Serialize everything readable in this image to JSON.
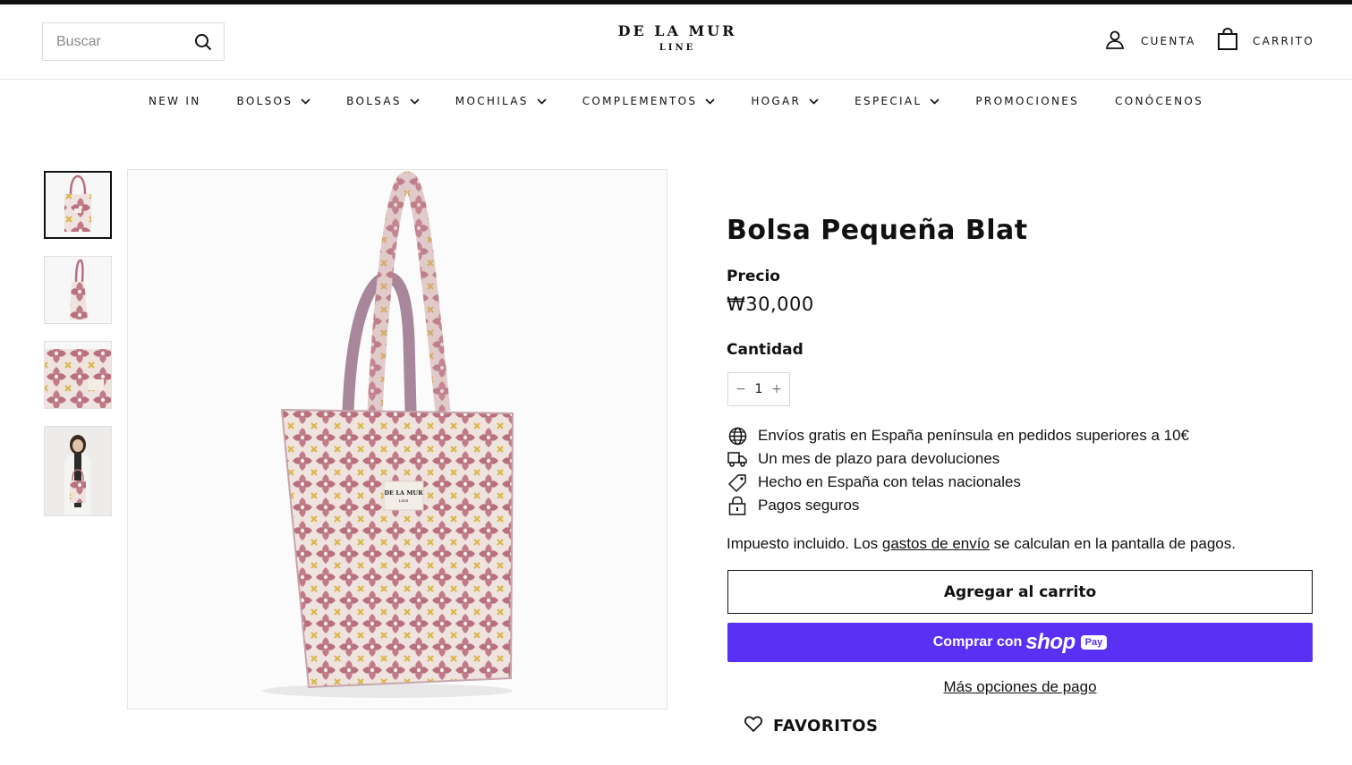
{
  "header": {
    "search_placeholder": "Buscar",
    "logo_line1": "DE LA MUR",
    "logo_line2": "LINE",
    "account_label": "CUENTA",
    "cart_label": "CARRITO"
  },
  "nav": {
    "items": [
      {
        "label": "NEW IN",
        "has_dropdown": false
      },
      {
        "label": "BOLSOS",
        "has_dropdown": true
      },
      {
        "label": "BOLSAS",
        "has_dropdown": true
      },
      {
        "label": "MOCHILAS",
        "has_dropdown": true
      },
      {
        "label": "COMPLEMENTOS",
        "has_dropdown": true
      },
      {
        "label": "HOGAR",
        "has_dropdown": true
      },
      {
        "label": "ESPECIAL",
        "has_dropdown": true
      },
      {
        "label": "PROMOCIONES",
        "has_dropdown": false
      },
      {
        "label": "CONÓCENOS",
        "has_dropdown": false
      }
    ]
  },
  "gallery": {
    "thumbnails": [
      "tote-front",
      "tote-side",
      "fabric-closeup",
      "model-holding-tote"
    ],
    "active_index": 0,
    "label_text_top": "DE LA MUR",
    "label_text_bottom": "LINE"
  },
  "product": {
    "title": "Bolsa Pequeña Blat",
    "price_label": "Precio",
    "price": "₩30,000",
    "quantity_label": "Cantidad",
    "quantity_value": "1",
    "features": [
      {
        "icon": "globe-icon",
        "text": "Envíos gratis en España península en pedidos superiores a 10€"
      },
      {
        "icon": "truck-icon",
        "text": "Un mes de plazo para devoluciones"
      },
      {
        "icon": "tag-icon",
        "text": "Hecho en España con telas nacionales"
      },
      {
        "icon": "lock-icon",
        "text": "Pagos seguros"
      }
    ],
    "tax_prefix": "Impuesto incluido. Los ",
    "tax_link": "gastos de envío",
    "tax_suffix": " se calculan en la pantalla de pagos.",
    "add_to_cart": "Agregar al carrito",
    "buy_with_prefix": "Comprar con",
    "buy_with_brand": "shop",
    "buy_with_badge": "Pay",
    "more_payment": "Más opciones de pago",
    "favorites": "FAVORITOS"
  },
  "colors": {
    "shop_pay": "#5a31f4",
    "text": "#111111",
    "fabric_pink": "#c07c88",
    "fabric_yellow": "#d9b64a"
  }
}
